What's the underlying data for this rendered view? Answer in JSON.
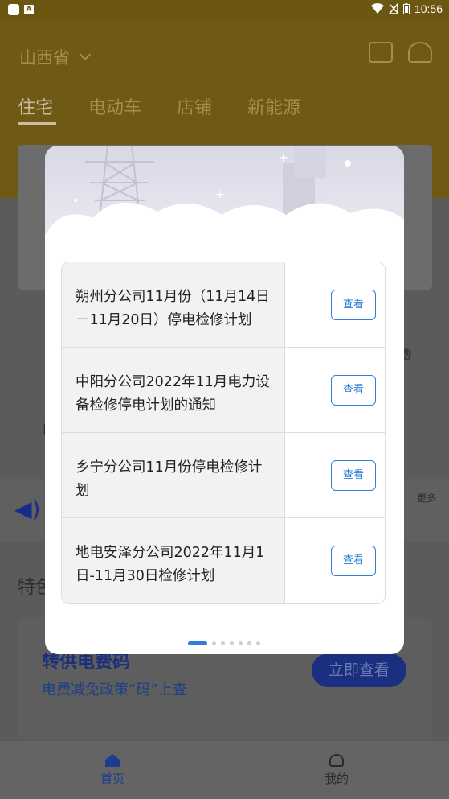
{
  "status_bar": {
    "time": "10:56",
    "icons": [
      "app-notification-icon",
      "a-notification-icon",
      "wifi-icon",
      "no-signal-icon",
      "battery-icon"
    ]
  },
  "header": {
    "province": "山西省",
    "tabs": [
      {
        "label": "住宅",
        "active": true
      },
      {
        "label": "电动车",
        "active": false
      },
      {
        "label": "店铺",
        "active": false
      },
      {
        "label": "新能源",
        "active": false
      }
    ],
    "icons": [
      "message-icon",
      "customer-service-icon"
    ]
  },
  "background": {
    "more_label": "更多",
    "section_title_partial": "特色",
    "promo": {
      "title": "转供电费码",
      "subtitle": "电费减免政策“码”上查",
      "button": "立即查看"
    }
  },
  "modal": {
    "notices": [
      {
        "title": "朔州分公司11月份（11月14日－11月20日）停电检修计划",
        "button": "查看"
      },
      {
        "title": "中阳分公司2022年11月电力设备检修停电计划的通知",
        "button": "查看"
      },
      {
        "title": "乡宁分公司11月份停电检修计划",
        "button": "查看"
      },
      {
        "title": "地电安泽分公司2022年11月1日-11月30日检修计划",
        "button": "查看"
      }
    ],
    "pager": {
      "total": 7,
      "current": 1
    }
  },
  "bottom_nav": {
    "items": [
      {
        "label": "首页",
        "icon": "home-icon",
        "active": true
      },
      {
        "label": "我的",
        "icon": "user-icon",
        "active": false
      }
    ]
  },
  "colors": {
    "brand_gold": "#f0c53a",
    "accent_blue": "#2f7fd6",
    "overlay": "rgba(0,0,0,0.6)"
  }
}
